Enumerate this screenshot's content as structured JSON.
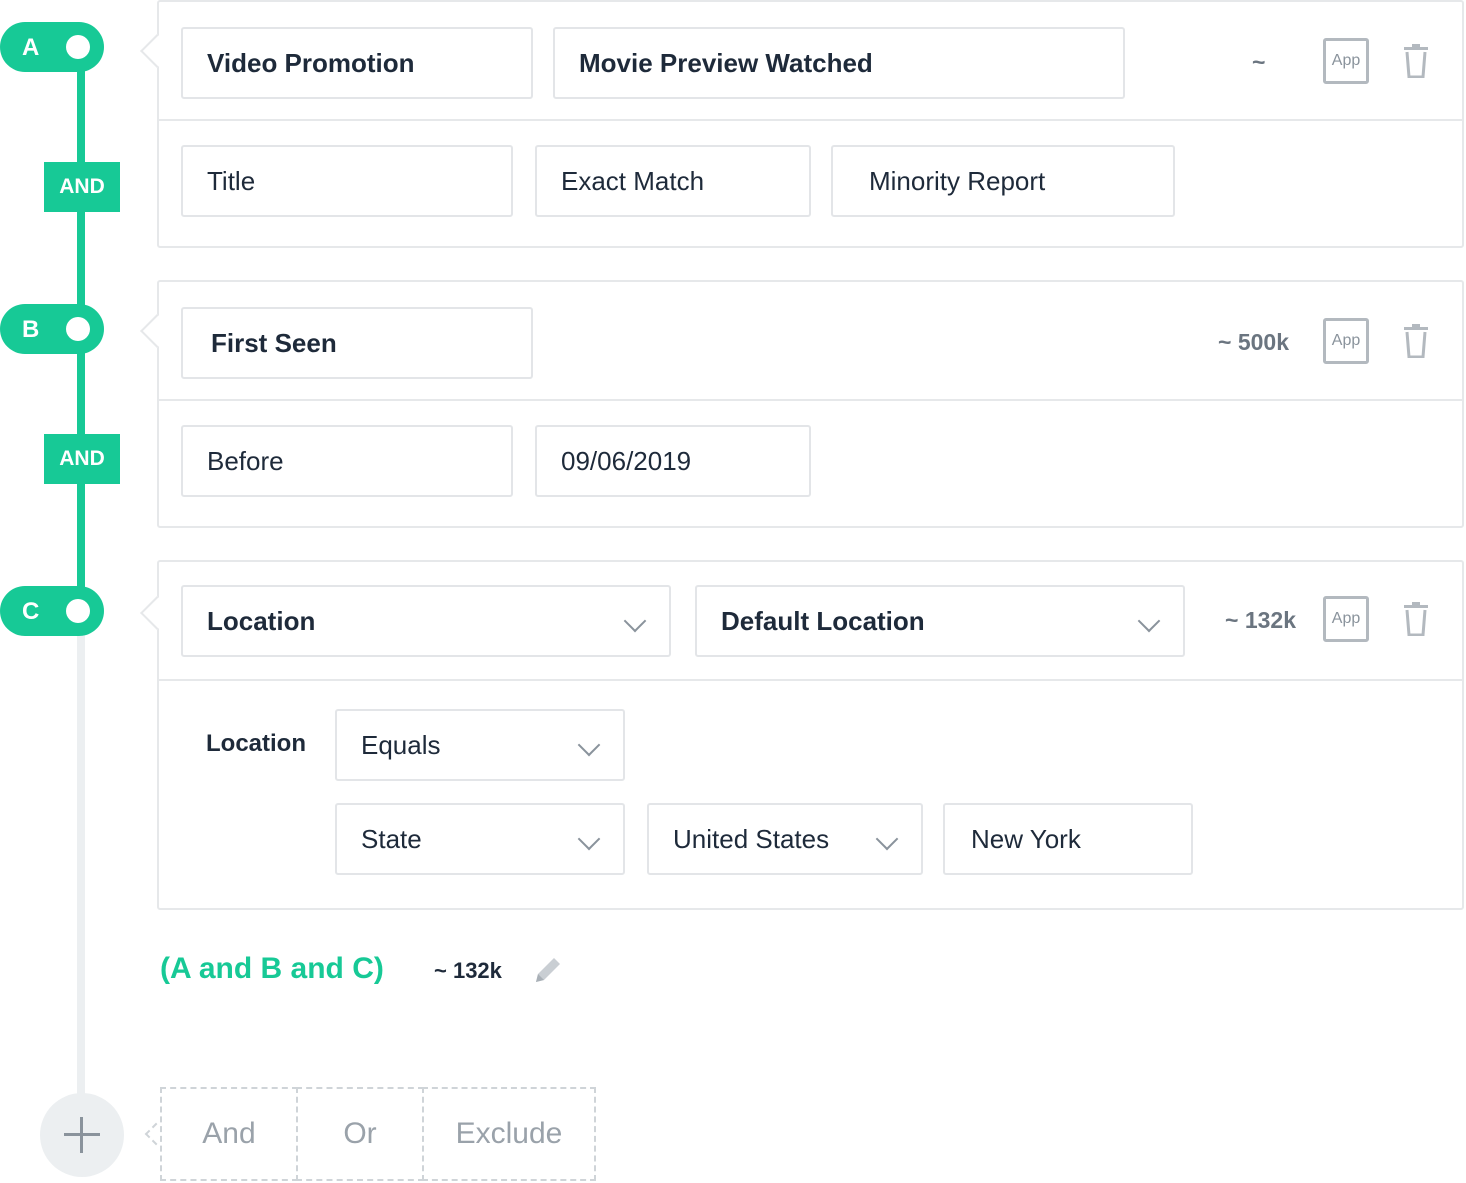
{
  "colors": {
    "accent": "#17c996",
    "border": "#e6e8ea",
    "muted": "#8a939c"
  },
  "timeline": {
    "markers": [
      "A",
      "B",
      "C"
    ],
    "connectors": [
      "AND",
      "AND"
    ]
  },
  "filters": [
    {
      "id": "A",
      "event_group": "Video Promotion",
      "event": "Movie Preview Watched",
      "count": "~",
      "app_label": "App",
      "condition": {
        "property": "Title",
        "operator": "Exact Match",
        "value": "Minority Report"
      }
    },
    {
      "id": "B",
      "event": "First Seen",
      "count": "~ 500k",
      "app_label": "App",
      "condition": {
        "operator": "Before",
        "value": "09/06/2019"
      }
    },
    {
      "id": "C",
      "event": "Location",
      "event_detail": "Default Location",
      "count": "~ 132k",
      "app_label": "App",
      "condition": {
        "label": "Location",
        "operator": "Equals",
        "level": "State",
        "country": "United States",
        "value": "New York"
      }
    }
  ],
  "summary": {
    "expression": "(A and B and C)",
    "count": "~ 132k",
    "edit_icon": "pencil-icon"
  },
  "add_options": [
    "And",
    "Or",
    "Exclude"
  ],
  "icons": [
    "trash-icon",
    "chevron-down-icon",
    "plus-icon",
    "pencil-icon"
  ]
}
